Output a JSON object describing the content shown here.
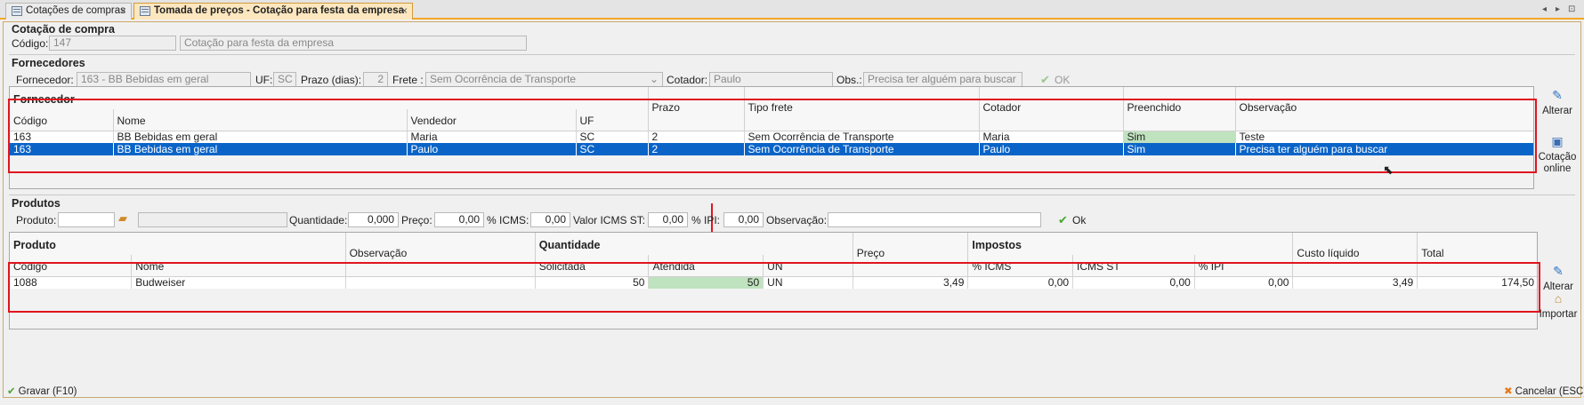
{
  "tabs": [
    {
      "label": "Cotações de compras",
      "close": "×"
    },
    {
      "label": "Tomada de preços - Cotação para festa da empresa",
      "close": "×"
    }
  ],
  "tab_nav": {
    "prev": "◂",
    "next": "▸",
    "menu": "⊡"
  },
  "header": {
    "section_title": "Cotação de compra",
    "code_label": "Código:",
    "code_value": "147",
    "description_value": "Cotação para festa da empresa"
  },
  "fornecedores": {
    "section_title": "Fornecedores",
    "form": {
      "fornecedor_label": "Fornecedor:",
      "fornecedor_value": "163 - BB Bebidas em geral",
      "uf_label": "UF:",
      "uf_value": "SC",
      "prazo_label": "Prazo (dias):",
      "prazo_value": "2",
      "frete_label": "Frete :",
      "frete_value": "Sem Ocorrência de Transporte",
      "cotador_label": "Cotador:",
      "cotador_value": "Paulo",
      "obs_label": "Obs.:",
      "obs_value": "Precisa ter alguém para buscar",
      "ok_label": "OK"
    },
    "grid": {
      "group_label": "Fornecedor",
      "columns": {
        "codigo": "Código",
        "nome": "Nome",
        "vendedor": "Vendedor",
        "uf": "UF",
        "prazo": "Prazo",
        "tipo_frete": "Tipo frete",
        "cotador": "Cotador",
        "preenchido": "Preenchido",
        "observacao": "Observação"
      },
      "rows": [
        {
          "codigo": "163",
          "nome": "BB Bebidas em geral",
          "vendedor": "Maria",
          "uf": "SC",
          "prazo": "2",
          "tipo_frete": "Sem Ocorrência de Transporte",
          "cotador": "Maria",
          "preenchido": "Sim",
          "observacao": "Teste"
        },
        {
          "codigo": "163",
          "nome": "BB Bebidas em geral",
          "vendedor": "Paulo",
          "uf": "SC",
          "prazo": "2",
          "tipo_frete": "Sem Ocorrência de Transporte",
          "cotador": "Paulo",
          "preenchido": "Sim",
          "observacao": "Precisa ter alguém para buscar"
        }
      ]
    },
    "side": {
      "alterar": "Alterar",
      "cotacao_online": "Cotação online"
    }
  },
  "produtos": {
    "section_title": "Produtos",
    "form": {
      "produto_label": "Produto:",
      "quantidade_label": "Quantidade:",
      "quantidade_value": "0,000",
      "preco_label": "Preço:",
      "preco_value": "0,00",
      "icms_label": "% ICMS:",
      "icms_value": "0,00",
      "valor_icms_st_label": "Valor ICMS ST:",
      "valor_icms_st_value": "0,00",
      "ipi_label": "% IPI:",
      "ipi_value": "0,00",
      "observacao_label": "Observação:",
      "ok_label": "Ok"
    },
    "grid": {
      "groups": {
        "produto": "Produto",
        "quantidade": "Quantidade",
        "impostos": "Impostos"
      },
      "columns": {
        "codigo": "Código",
        "nome": "Nome",
        "observacao": "Observação",
        "solicitada": "Solicitada",
        "atendida": "Atendida",
        "un": "UN",
        "preco": "Preço",
        "icms": "% ICMS",
        "icms_st": "ICMS ST",
        "ipi": "% IPI",
        "custo_liquido": "Custo líquido",
        "total": "Total"
      },
      "rows": [
        {
          "codigo": "1088",
          "nome": "Budweiser",
          "observacao": "",
          "solicitada": "50",
          "atendida": "50",
          "un": "UN",
          "preco": "3,49",
          "icms": "0,00",
          "icms_st": "0,00",
          "ipi": "0,00",
          "custo_liquido": "3,49",
          "total": "174,50"
        }
      ]
    },
    "side": {
      "alterar": "Alterar",
      "importar": "Importar"
    }
  },
  "footer": {
    "gravar": "Gravar (F10)",
    "cancelar": "Cancelar (ESC)"
  },
  "colors": {
    "accent_orange": "#f5a623",
    "selection_blue": "#0a64c8",
    "highlight_red": "#e0141e",
    "filled_green": "#bfe2bf"
  }
}
